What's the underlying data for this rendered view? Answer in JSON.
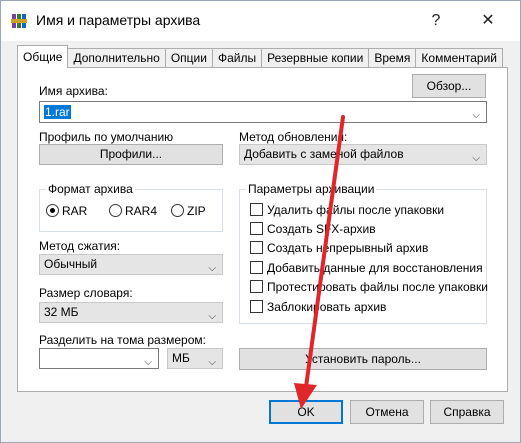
{
  "window": {
    "title": "Имя и параметры архива",
    "help_glyph": "?",
    "close_glyph": "✕"
  },
  "tabs": [
    {
      "label": "Общие",
      "active": true
    },
    {
      "label": "Дополнительно"
    },
    {
      "label": "Опции"
    },
    {
      "label": "Файлы"
    },
    {
      "label": "Резервные копии"
    },
    {
      "label": "Время"
    },
    {
      "label": "Комментарий"
    }
  ],
  "archive_name": {
    "label": "Имя архива:",
    "value": "1.rar",
    "browse_label": "Обзор..."
  },
  "profile": {
    "label": "Профиль по умолчанию",
    "button_label": "Профили..."
  },
  "update_method": {
    "label": "Метод обновления:",
    "value": "Добавить с заменой файлов"
  },
  "format": {
    "caption": "Формат архива",
    "options": [
      "RAR",
      "RAR4",
      "ZIP"
    ],
    "selected": "RAR"
  },
  "compression": {
    "label": "Метод сжатия:",
    "value": "Обычный"
  },
  "dictionary": {
    "label": "Размер словаря:",
    "value": "32 МБ"
  },
  "split": {
    "label": "Разделить на тома размером:",
    "value": "",
    "unit": "МБ"
  },
  "archiving_options": {
    "caption": "Параметры архивации",
    "items": [
      "Удалить файлы после упаковки",
      "Создать SFX-архив",
      "Создать непрерывный архив",
      "Добавить данные для восстановления",
      "Протестировать файлы после упаковки",
      "Заблокировать архив"
    ]
  },
  "password_button": "Установить пароль...",
  "footer": {
    "ok": "OK",
    "cancel": "Отмена",
    "help": "Справка"
  },
  "colors": {
    "selection": "#0078d7",
    "annotation_arrow": "#e0252b"
  }
}
